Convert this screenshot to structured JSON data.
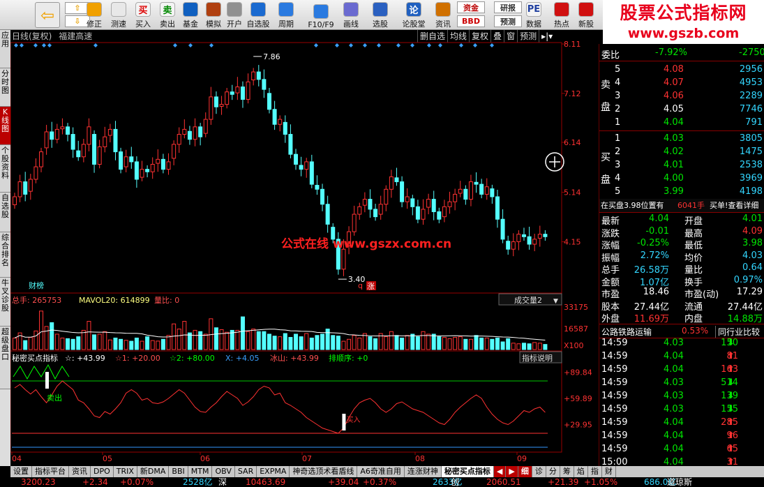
{
  "toolbar": {
    "buttons": [
      {
        "label": "修正",
        "icon": "refresh-icon"
      },
      {
        "label": "测速",
        "icon": "clock-icon"
      },
      {
        "label": "买入",
        "icon": "buy-icon",
        "glyph": "买"
      },
      {
        "label": "卖出",
        "icon": "sell-icon",
        "glyph": "卖"
      },
      {
        "label": "基金",
        "icon": "fund-icon"
      },
      {
        "label": "模拟",
        "icon": "gavel-icon"
      },
      {
        "label": "开户",
        "icon": "lock-icon"
      },
      {
        "label": "自选股",
        "icon": "star-icon"
      },
      {
        "label": "周期",
        "icon": "period-icon"
      },
      {
        "label": "F10/F9",
        "icon": "f10-icon"
      },
      {
        "label": "画线",
        "icon": "pen-icon"
      },
      {
        "label": "选股",
        "icon": "select-icon"
      },
      {
        "label": "论股堂",
        "icon": "forum-icon",
        "glyph": "论"
      },
      {
        "label": "资讯",
        "icon": "news-icon"
      },
      {
        "label": "数据",
        "icon": "pe-icon",
        "glyph": "PE"
      },
      {
        "label": "热点",
        "icon": "hot-icon"
      },
      {
        "label": "新股",
        "icon": "newstock-icon"
      }
    ],
    "small": [
      "资金",
      "BBD",
      "研报",
      "预测"
    ]
  },
  "brand": {
    "line1": "股票公式指标网",
    "line2": "www.gszb.com"
  },
  "left_tabs": [
    "应用",
    "分时图",
    "K线图",
    "个股资料",
    "自选股",
    "综合排名",
    "牛叉诊股",
    "超级盘口"
  ],
  "title": {
    "period": "日线(复权)",
    "stock": "福建高速"
  },
  "title_buttons": [
    "删自选",
    "均线",
    "复权",
    "叠",
    "窗",
    "预测"
  ],
  "watermark": "公式在线 www.gszx.com.cn",
  "chart_labels": {
    "high": "7.86",
    "low": "3.40",
    "caibao": "财榜",
    "q_label": "q",
    "zhang": "涨"
  },
  "vol_panel": {
    "header_total": "总手: 265753",
    "mavol": "MAVOL20: 614899",
    "ratio": "量比: 0",
    "selector": "成交量2",
    "scale": [
      "33175",
      "16587",
      "X100"
    ]
  },
  "ind_panel": {
    "name": "秘密买点指标",
    "a": "☆: +43.99",
    "a1": "☆1: +20.00",
    "a2": "☆2: +80.00",
    "x": "X: +4.05",
    "ice": "冰山: +43.99",
    "rank": "排顺序: +0",
    "explain": "指标说明",
    "scale": [
      "+89.84",
      "+59.89",
      "+29.95"
    ],
    "sell": "卖出",
    "buy": "买入"
  },
  "xaxis": [
    "04",
    "05",
    "06",
    "07",
    "08",
    "09"
  ],
  "chart_data": [
    {
      "type": "candlestick",
      "title": "日线(复权) 福建高速",
      "y_ticks": [
        "8.11",
        "7.12",
        "6.14",
        "5.14",
        "4.15"
      ],
      "ylim": [
        3.15,
        8.11
      ],
      "x_month_labels": [
        "04",
        "05",
        "06",
        "07",
        "08",
        "09"
      ],
      "annotations": {
        "max": 7.86,
        "min": 3.4
      },
      "candles_close": [
        5.05,
        5.35,
        5.1,
        5.4,
        5.65,
        5.95,
        6.35,
        6.2,
        6.4,
        6.45,
        6.3,
        6.0,
        5.85,
        6.1,
        6.45,
        5.7,
        6.05,
        6.25,
        6.4,
        5.95,
        5.6,
        5.85,
        5.75,
        5.4,
        5.6,
        5.55,
        5.7,
        5.8,
        5.6,
        5.75,
        6.1,
        6.3,
        6.4,
        6.2,
        6.45,
        6.25,
        6.6,
        7.05,
        6.85,
        6.9,
        7.15,
        7.1,
        7.25,
        7.0,
        7.35,
        7.55,
        7.4,
        7.2,
        6.8,
        6.5,
        6.6,
        6.3,
        5.9,
        5.7,
        5.6,
        5.75,
        5.3,
        5.2,
        4.9,
        4.5,
        4.2,
        3.6,
        4.0,
        4.35,
        4.7,
        4.85,
        5.0,
        4.8,
        4.65,
        4.9,
        5.2,
        5.45,
        5.35,
        4.95,
        5.05,
        4.85,
        4.6,
        4.8,
        5.0,
        4.75,
        4.6,
        4.85,
        4.95,
        5.1,
        5.2,
        5.0,
        5.35,
        5.3,
        5.1,
        5.25,
        5.05,
        4.6,
        4.2,
        4.0,
        4.15,
        4.3,
        4.25,
        4.1,
        4.2,
        4.3,
        4.25
      ],
      "volume_panel": {
        "ylim": [
          0,
          33175
        ],
        "values_x100": [
          9000,
          13000,
          7000,
          9500,
          14500,
          30000,
          18000,
          21000,
          12000,
          9000,
          8500,
          8000,
          10000,
          15000,
          22000,
          11500,
          12000,
          14000,
          7500,
          9000,
          8000,
          7200,
          6500,
          9000,
          6500,
          10000,
          7000,
          6600,
          8000,
          11000,
          20000,
          16000,
          22000,
          13000,
          15000,
          14000,
          12000,
          24000,
          17000,
          15500,
          13500,
          15000,
          15000,
          25500,
          14000,
          16000,
          14000,
          14000,
          12000,
          10500,
          10000,
          12500,
          9500,
          12000,
          10000,
          12500,
          9000,
          11000,
          12000,
          16000,
          11000,
          10500,
          6500,
          8000,
          11000,
          9000,
          12500,
          10000,
          8500,
          12500,
          10000,
          14000,
          11000,
          9000,
          11000,
          12000,
          10000,
          14000,
          12000,
          12000,
          10000,
          9500,
          8500,
          9500,
          10000,
          8000,
          8000,
          11000,
          9000,
          9000,
          8000,
          9000,
          6000,
          8500,
          5000,
          4500,
          5000,
          4500,
          5500,
          5000,
          4000
        ]
      },
      "indicator_panel": {
        "ylim": [
          0,
          100
        ],
        "star": [
          72,
          76,
          70,
          65,
          70,
          62,
          55,
          64,
          74,
          80,
          75,
          70,
          58,
          55,
          48,
          40,
          38,
          45,
          42,
          48,
          55,
          66,
          70,
          66,
          58,
          60,
          55,
          54,
          56,
          60,
          65,
          70,
          66,
          58,
          50,
          45,
          44,
          50,
          55,
          62,
          68,
          64,
          60,
          52,
          56,
          62,
          70,
          74,
          72,
          64,
          66,
          55,
          52,
          48,
          44,
          38,
          34,
          30,
          26,
          24,
          22,
          20,
          26,
          38,
          48,
          55,
          58,
          60,
          55,
          48,
          44,
          48,
          54,
          56,
          52,
          48,
          46,
          44,
          40,
          36,
          32,
          30,
          36,
          44,
          50,
          55,
          60,
          64,
          60,
          50,
          42,
          36,
          32,
          30,
          34,
          40,
          46,
          44,
          48,
          50,
          44
        ],
        "line_top": 80,
        "line_low": 20,
        "bottom": 4.05
      }
    }
  ],
  "right_panel": {
    "weibi_label": "委比",
    "weibi_val": "-7.92%",
    "weibi_diff": "-2750",
    "sell_label": [
      "卖",
      "盘"
    ],
    "buy_label": [
      "买",
      "盘"
    ],
    "asks": [
      {
        "n": "5",
        "p": "4.08",
        "v": "2956"
      },
      {
        "n": "4",
        "p": "4.07",
        "v": "4953"
      },
      {
        "n": "3",
        "p": "4.06",
        "v": "2289"
      },
      {
        "n": "2",
        "p": "4.05",
        "v": "7746"
      },
      {
        "n": "1",
        "p": "4.04",
        "v": "791"
      }
    ],
    "bids": [
      {
        "n": "1",
        "p": "4.03",
        "v": "3805"
      },
      {
        "n": "2",
        "p": "4.02",
        "v": "1475"
      },
      {
        "n": "3",
        "p": "4.01",
        "v": "2538"
      },
      {
        "n": "4",
        "p": "4.00",
        "v": "3969"
      },
      {
        "n": "5",
        "p": "3.99",
        "v": "4198"
      }
    ],
    "position_info": "在买盘3.98位置有",
    "position_qty": "6041手",
    "position_link": "买单!查看详细",
    "quote": [
      [
        "最新",
        "4.04",
        "开盘",
        "4.01"
      ],
      [
        "涨跌",
        "-0.01",
        "最高",
        "4.09"
      ],
      [
        "涨幅",
        "-0.25%",
        "最低",
        "3.98"
      ],
      [
        "振幅",
        "2.72%",
        "均价",
        "4.03"
      ],
      [
        "总手",
        "26.58万",
        "量比",
        "0.64"
      ],
      [
        "金额",
        "1.07亿",
        "换手",
        "0.97%"
      ],
      [
        "市盈",
        "18.46",
        "市盈(动)",
        "17.29"
      ],
      [
        "股本",
        "27.44亿",
        "流通",
        "27.44亿"
      ],
      [
        "外盘",
        "11.69万",
        "内盘",
        "14.88万"
      ]
    ],
    "industry": "公路铁路运输",
    "industry_pct": "0.53%",
    "industry_btn": "同行业比较",
    "ticks": [
      {
        "t": "14:59",
        "p": "4.03",
        "v": "150",
        "dir": "down"
      },
      {
        "t": "14:59",
        "p": "4.04",
        "v": "81",
        "dir": "up"
      },
      {
        "t": "14:59",
        "p": "4.04",
        "v": "163",
        "dir": "up"
      },
      {
        "t": "14:59",
        "p": "4.03",
        "v": "514",
        "dir": "down"
      },
      {
        "t": "14:59",
        "p": "4.03",
        "v": "139",
        "dir": "down"
      },
      {
        "t": "14:59",
        "p": "4.03",
        "v": "155",
        "dir": "down"
      },
      {
        "t": "14:59",
        "p": "4.04",
        "v": "285",
        "dir": "up"
      },
      {
        "t": "14:59",
        "p": "4.04",
        "v": "96",
        "dir": "up"
      },
      {
        "t": "14:59",
        "p": "4.04",
        "v": "65",
        "dir": "up"
      },
      {
        "t": "15:00",
        "p": "4.04",
        "v": "31",
        "dir": "up"
      }
    ],
    "bottom_tabs": [
      "细",
      "诊",
      "分",
      "筹",
      "焰",
      "指",
      "财"
    ]
  },
  "bottom_tabs": [
    "设置",
    "指标平台",
    "资讯",
    "DPO",
    "TRIX",
    "新DMA",
    "BBI",
    "MTM",
    "OBV",
    "SAR",
    "EXPMA",
    "神奇选顶术看盾线",
    "A6奇准自用",
    "连涨财神",
    "秘密买点指标"
  ],
  "status": [
    "3200.23",
    "+2.34",
    "+0.07%",
    "2528亿",
    "深",
    "10463.69",
    "+39.04",
    "+0.37%",
    "2633亿",
    "创",
    "2060.51",
    "+21.39",
    "+1.05%",
    "686.0亿",
    "道琼斯"
  ],
  "colors": {
    "up": "#ff3232",
    "down": "#54ffff",
    "ma": "#ffffff",
    "ind_line": "#ff3232",
    "ind_top": "#00c800",
    "ind_bottom": "#3399ff"
  }
}
